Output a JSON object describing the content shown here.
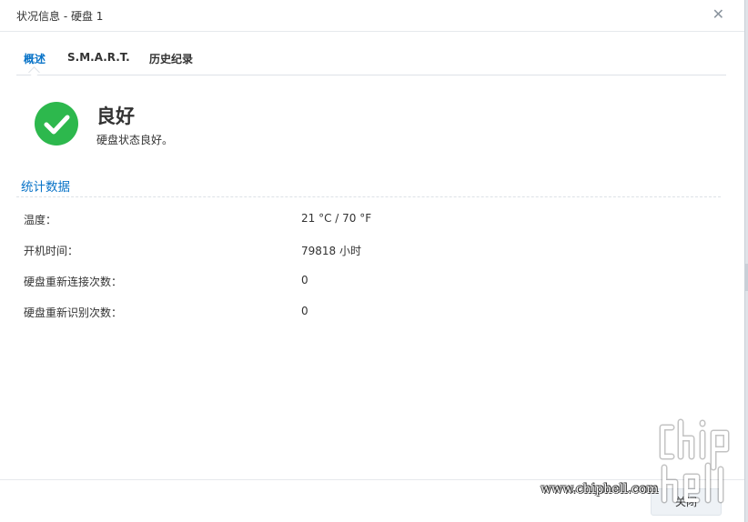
{
  "window": {
    "title": "状况信息 - 硬盘 1",
    "close_glyph": "✕"
  },
  "tabs": [
    {
      "label": "概述",
      "active": true
    },
    {
      "label": "S.M.A.R.T.",
      "active": false
    },
    {
      "label": "历史纪录",
      "active": false
    }
  ],
  "status": {
    "title": "良好",
    "description": "硬盘状态良好。",
    "color": "#2db84d"
  },
  "statistics": {
    "title": "统计数据",
    "rows": [
      {
        "label": "温度：",
        "value": "21 °C / 70 °F"
      },
      {
        "label": "开机时间：",
        "value": "79818 小时"
      },
      {
        "label": "硬盘重新连接次数：",
        "value": "0"
      },
      {
        "label": "硬盘重新识别次数：",
        "value": "0"
      }
    ]
  },
  "footer": {
    "close_label": "关闭"
  },
  "watermark": {
    "text": "www.chiphell.com",
    "logo_text": "chip hell"
  },
  "colors": {
    "accent": "#0a74c8",
    "success": "#2db84d"
  }
}
